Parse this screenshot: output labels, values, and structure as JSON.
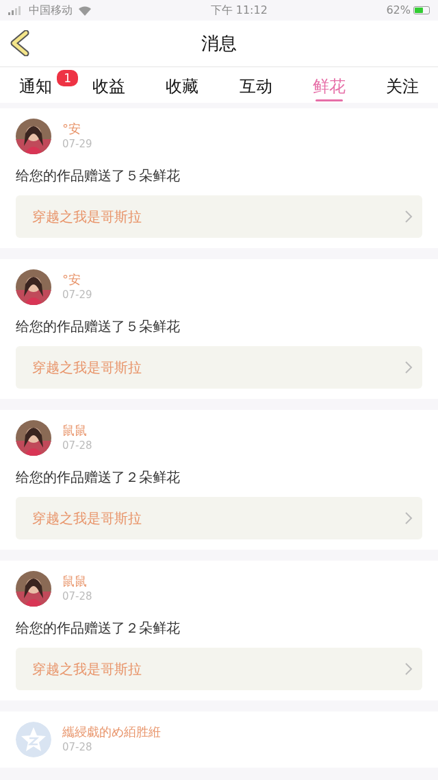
{
  "status_bar": {
    "carrier": "中国移动",
    "time": "下午 11:12",
    "battery": "62%"
  },
  "header": {
    "title": "消息"
  },
  "tabs": [
    {
      "label": "通知",
      "badge": "1",
      "selected": false
    },
    {
      "label": "收益",
      "selected": false
    },
    {
      "label": "收藏",
      "selected": false
    },
    {
      "label": "互动",
      "selected": false
    },
    {
      "label": "鲜花",
      "selected": true
    },
    {
      "label": "关注",
      "selected": false
    }
  ],
  "messages": [
    {
      "name": "°安",
      "date": "07-29",
      "text": "给您的作品赠送了５朵鲜花",
      "work": "穿越之我是哥斯拉"
    },
    {
      "name": "°安",
      "date": "07-29",
      "text": "给您的作品赠送了５朵鲜花",
      "work": "穿越之我是哥斯拉"
    },
    {
      "name": "鼠鼠",
      "date": "07-28",
      "text": "给您的作品赠送了２朵鲜花",
      "work": "穿越之我是哥斯拉"
    },
    {
      "name": "鼠鼠",
      "date": "07-28",
      "text": "给您的作品赠送了２朵鲜花",
      "work": "穿越之我是哥斯拉"
    },
    {
      "avatar": {
        "kind": "default"
      },
      "name": "纗綅戱的め絔胜絍",
      "date": "07-28"
    }
  ]
}
